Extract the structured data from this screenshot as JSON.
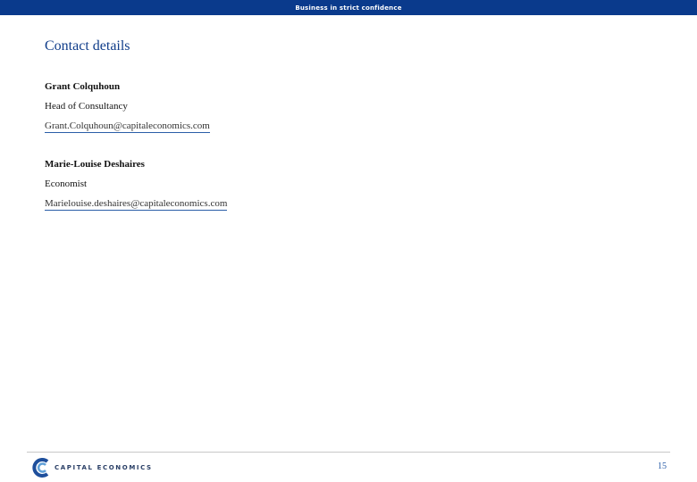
{
  "header": {
    "confidential_text": "Business in strict confidence"
  },
  "page": {
    "title": "Contact details"
  },
  "contacts": [
    {
      "name": "Grant Colquhoun",
      "role": "Head of Consultancy",
      "email": "Grant.Colquhoun@capitaleconomics.com"
    },
    {
      "name": "Marie-Louise Deshaires",
      "role": "Economist",
      "email": "Marielouise.deshaires@capitaleconomics.com"
    }
  ],
  "footer": {
    "logo_text": "CAPITAL ECONOMICS",
    "page_number": "15"
  },
  "colors": {
    "header_bar": "#0a3a8c",
    "title": "#103d8a",
    "link_underline": "#2a5ea8"
  }
}
